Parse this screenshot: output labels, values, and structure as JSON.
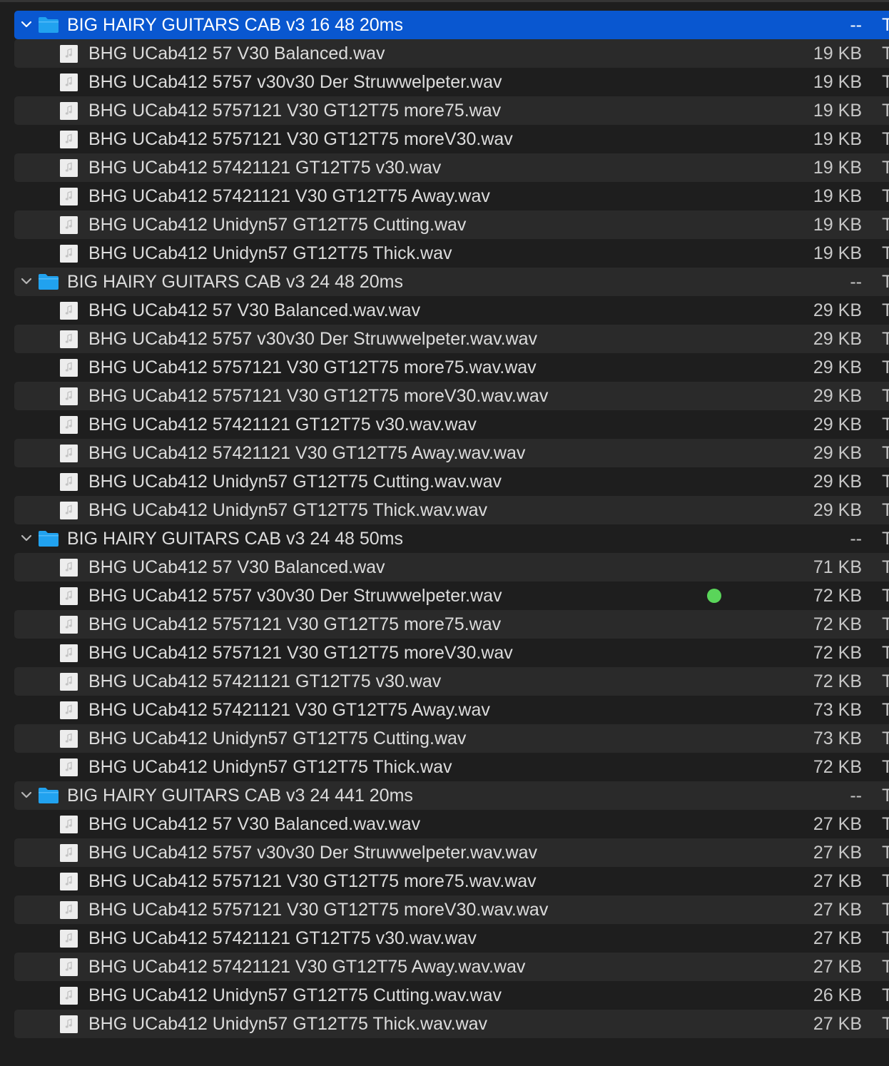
{
  "colors": {
    "background": "#1e1e1e",
    "alt_row": "#2a2a2a",
    "selection": "#0957d0",
    "folder": "#21a2ef",
    "tag_green": "#5ad55a"
  },
  "groups": [
    {
      "name": "BIG HAIRY GUITARS CAB v3 16 48 20ms",
      "size": "--",
      "kind": "T",
      "expanded": true,
      "selected": true,
      "files": [
        {
          "name": "BHG UCab412 57 V30 Balanced.wav",
          "size": "19 KB",
          "kind": "T"
        },
        {
          "name": "BHG UCab412 5757 v30v30 Der Struwwelpeter.wav",
          "size": "19 KB",
          "kind": "T"
        },
        {
          "name": "BHG UCab412 5757121 V30 GT12T75 more75.wav",
          "size": "19 KB",
          "kind": "T"
        },
        {
          "name": "BHG UCab412 5757121 V30 GT12T75 moreV30.wav",
          "size": "19 KB",
          "kind": "T"
        },
        {
          "name": "BHG UCab412 57421121 GT12T75 v30.wav",
          "size": "19 KB",
          "kind": "T"
        },
        {
          "name": "BHG UCab412 57421121 V30 GT12T75 Away.wav",
          "size": "19 KB",
          "kind": "T"
        },
        {
          "name": "BHG UCab412 Unidyn57 GT12T75 Cutting.wav",
          "size": "19 KB",
          "kind": "T"
        },
        {
          "name": "BHG UCab412 Unidyn57 GT12T75 Thick.wav",
          "size": "19 KB",
          "kind": "T"
        }
      ]
    },
    {
      "name": "BIG HAIRY GUITARS CAB v3 24 48 20ms",
      "size": "--",
      "kind": "T",
      "expanded": true,
      "selected": false,
      "files": [
        {
          "name": "BHG UCab412 57 V30 Balanced.wav.wav",
          "size": "29 KB",
          "kind": "T"
        },
        {
          "name": "BHG UCab412 5757 v30v30 Der Struwwelpeter.wav.wav",
          "size": "29 KB",
          "kind": "T"
        },
        {
          "name": "BHG UCab412 5757121 V30 GT12T75 more75.wav.wav",
          "size": "29 KB",
          "kind": "T"
        },
        {
          "name": "BHG UCab412 5757121 V30 GT12T75 moreV30.wav.wav",
          "size": "29 KB",
          "kind": "T"
        },
        {
          "name": "BHG UCab412 57421121 GT12T75 v30.wav.wav",
          "size": "29 KB",
          "kind": "T"
        },
        {
          "name": "BHG UCab412 57421121 V30 GT12T75 Away.wav.wav",
          "size": "29 KB",
          "kind": "T"
        },
        {
          "name": "BHG UCab412 Unidyn57 GT12T75 Cutting.wav.wav",
          "size": "29 KB",
          "kind": "T"
        },
        {
          "name": "BHG UCab412 Unidyn57 GT12T75 Thick.wav.wav",
          "size": "29 KB",
          "kind": "T"
        }
      ]
    },
    {
      "name": "BIG HAIRY GUITARS CAB v3 24 48 50ms",
      "size": "--",
      "kind": "T",
      "expanded": true,
      "selected": false,
      "files": [
        {
          "name": "BHG UCab412 57 V30 Balanced.wav",
          "size": "71 KB",
          "kind": "T"
        },
        {
          "name": "BHG UCab412 5757 v30v30 Der Struwwelpeter.wav",
          "size": "72 KB",
          "kind": "T",
          "tag": "green"
        },
        {
          "name": "BHG UCab412 5757121 V30 GT12T75 more75.wav",
          "size": "72 KB",
          "kind": "T"
        },
        {
          "name": "BHG UCab412 5757121 V30 GT12T75 moreV30.wav",
          "size": "72 KB",
          "kind": "T"
        },
        {
          "name": "BHG UCab412 57421121 GT12T75 v30.wav",
          "size": "72 KB",
          "kind": "T"
        },
        {
          "name": "BHG UCab412 57421121 V30 GT12T75 Away.wav",
          "size": "73 KB",
          "kind": "T"
        },
        {
          "name": "BHG UCab412 Unidyn57 GT12T75 Cutting.wav",
          "size": "73 KB",
          "kind": "T"
        },
        {
          "name": "BHG UCab412 Unidyn57 GT12T75 Thick.wav",
          "size": "72 KB",
          "kind": "T"
        }
      ]
    },
    {
      "name": "BIG HAIRY GUITARS CAB v3 24 441 20ms",
      "size": "--",
      "kind": "T",
      "expanded": true,
      "selected": false,
      "files": [
        {
          "name": "BHG UCab412 57 V30 Balanced.wav.wav",
          "size": "27 KB",
          "kind": "T"
        },
        {
          "name": "BHG UCab412 5757 v30v30 Der Struwwelpeter.wav.wav",
          "size": "27 KB",
          "kind": "T"
        },
        {
          "name": "BHG UCab412 5757121 V30 GT12T75 more75.wav.wav",
          "size": "27 KB",
          "kind": "T"
        },
        {
          "name": "BHG UCab412 5757121 V30 GT12T75 moreV30.wav.wav",
          "size": "27 KB",
          "kind": "T"
        },
        {
          "name": "BHG UCab412 57421121 GT12T75 v30.wav.wav",
          "size": "27 KB",
          "kind": "T"
        },
        {
          "name": "BHG UCab412 57421121 V30 GT12T75 Away.wav.wav",
          "size": "27 KB",
          "kind": "T"
        },
        {
          "name": "BHG UCab412 Unidyn57 GT12T75 Cutting.wav.wav",
          "size": "26 KB",
          "kind": "T"
        },
        {
          "name": "BHG UCab412 Unidyn57 GT12T75 Thick.wav.wav",
          "size": "27 KB",
          "kind": "T"
        }
      ]
    }
  ]
}
